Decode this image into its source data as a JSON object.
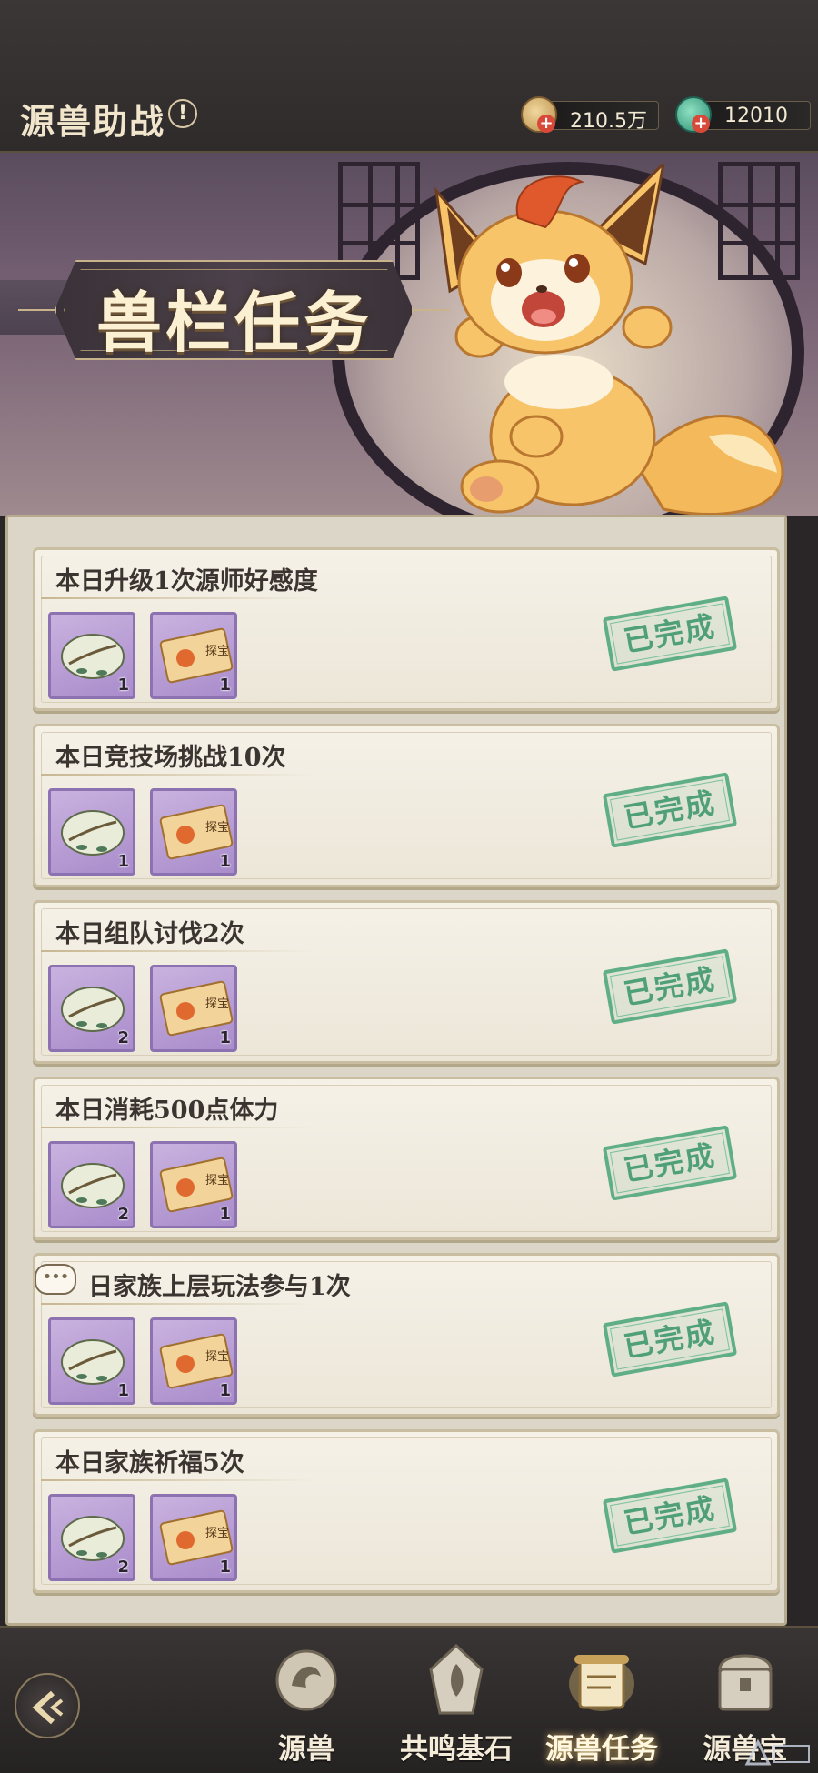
{
  "header": {
    "title": "源兽助战",
    "info_glyph": "!",
    "currencies": [
      {
        "name": "coin",
        "value": "210.5万"
      },
      {
        "name": "gem",
        "value": "12010"
      }
    ]
  },
  "banner": {
    "title": "兽栏任务"
  },
  "tasks": [
    {
      "title": "本日升级1次源师好感度",
      "rewards": [
        {
          "count": "1"
        },
        {
          "count": "1"
        }
      ],
      "status": "已完成"
    },
    {
      "title": "本日竞技场挑战10次",
      "rewards": [
        {
          "count": "1"
        },
        {
          "count": "1"
        }
      ],
      "status": "已完成"
    },
    {
      "title": "本日组队讨伐2次",
      "rewards": [
        {
          "count": "2"
        },
        {
          "count": "1"
        }
      ],
      "status": "已完成"
    },
    {
      "title": "本日消耗500点体力",
      "rewards": [
        {
          "count": "2"
        },
        {
          "count": "1"
        }
      ],
      "status": "已完成"
    },
    {
      "title": "日家族上层玩法参与1次",
      "rewards": [
        {
          "count": "1"
        },
        {
          "count": "1"
        }
      ],
      "status": "已完成"
    },
    {
      "title": "本日家族祈福5次",
      "rewards": [
        {
          "count": "2"
        },
        {
          "count": "1"
        }
      ],
      "status": "已完成"
    }
  ],
  "reward_items": {
    "item_1": {
      "icon": "seed-shell-icon"
    },
    "item_2": {
      "icon": "treasure-ticket-icon",
      "label": "探宝"
    }
  },
  "chat": {
    "glyph": "•••"
  },
  "nav": {
    "tabs": [
      {
        "label": "源兽",
        "icon": "dragon-crest-icon"
      },
      {
        "label": "共鸣基石",
        "icon": "resonance-stone-icon"
      },
      {
        "label": "源兽任务",
        "icon": "scroll-task-icon",
        "active": true
      },
      {
        "label": "源兽宝",
        "icon": "treasure-chest-icon"
      }
    ]
  },
  "colors": {
    "stamp_green": "#5fae86",
    "reward_bg": "#a98ccb",
    "header_bg": "#2f2b2b",
    "card_bg": "#f5f1e7"
  }
}
